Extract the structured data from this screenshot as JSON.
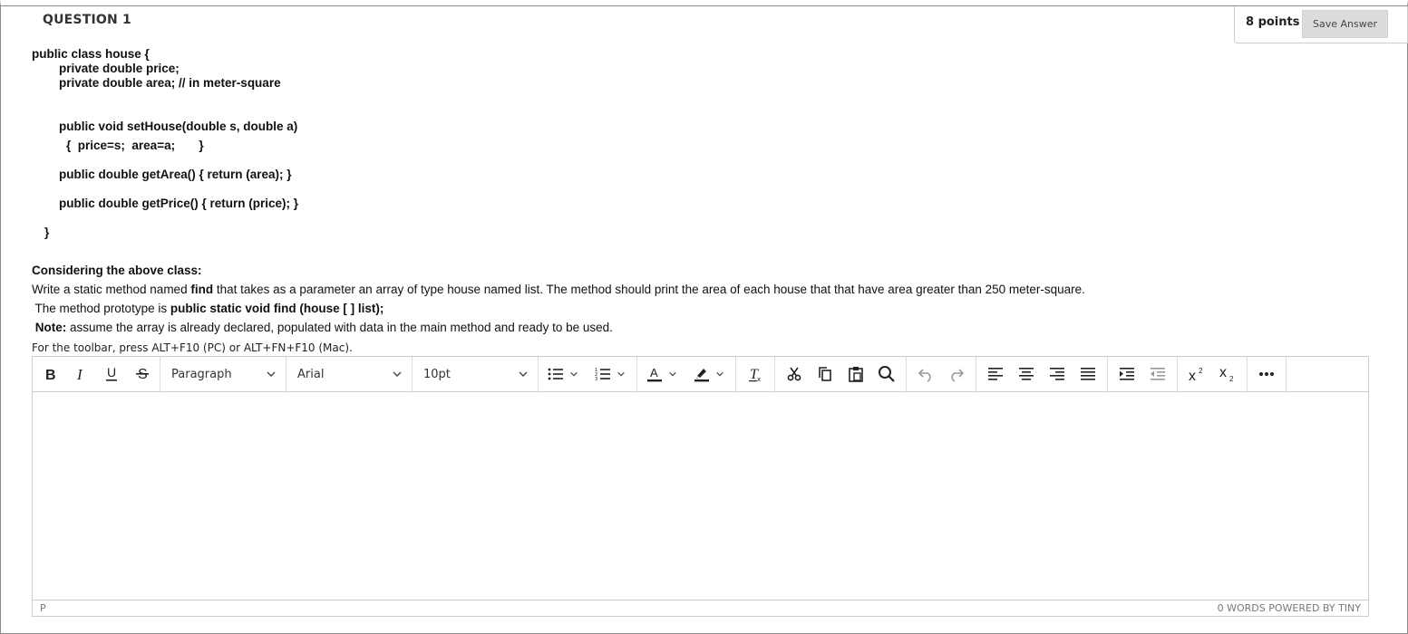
{
  "question": {
    "title": "QUESTION 1",
    "points": "8 points",
    "save_label": "Save Answer"
  },
  "code_lines": [
    "public class house {",
    "private double price;",
    "private double area; // in meter-square",
    "public void setHouse(double s, double a)",
    "{  price=s;  area=a;       }",
    "public double getArea() { return (area); }",
    "public double getPrice() { return (price); }",
    "}"
  ],
  "prompt": {
    "heading": "Considering the above class:",
    "line1_a": "Write a static method named ",
    "line1_b": "find",
    "line1_c": " that takes as a parameter an array of type house named list. The method should print the area of each house that that have area greater than 250 meter-square.",
    "line2_a": " The method prototype is ",
    "line2_b": "public static void find (house [ ] list);",
    "line3_a": " Note:",
    "line3_b": " assume the array is already declared, populated with data in the main method and ready to be used."
  },
  "editor": {
    "toolbar_hint": "For the toolbar, press ALT+F10 (PC) or ALT+FN+F10 (Mac).",
    "block_format": "Paragraph",
    "font_family": "Arial",
    "font_size": "10pt",
    "content": "",
    "status_path": "P",
    "status_right": "0 WORDS  POWERED BY TINY"
  },
  "colors": {
    "border": "#cccccc",
    "save_button_bg": "#dcdcdc",
    "text": "#111111"
  },
  "icons": [
    "bold-icon",
    "italic-icon",
    "underline-icon",
    "strikethrough-icon",
    "bullet-list-icon",
    "numbered-list-icon",
    "text-color-icon",
    "highlight-icon",
    "clear-formatting-icon",
    "cut-icon",
    "copy-icon",
    "paste-icon",
    "find-icon",
    "undo-icon",
    "redo-icon",
    "align-left-icon",
    "align-center-icon",
    "align-right-icon",
    "justify-icon",
    "indent-icon",
    "outdent-icon",
    "superscript-icon",
    "subscript-icon",
    "more-icon"
  ]
}
